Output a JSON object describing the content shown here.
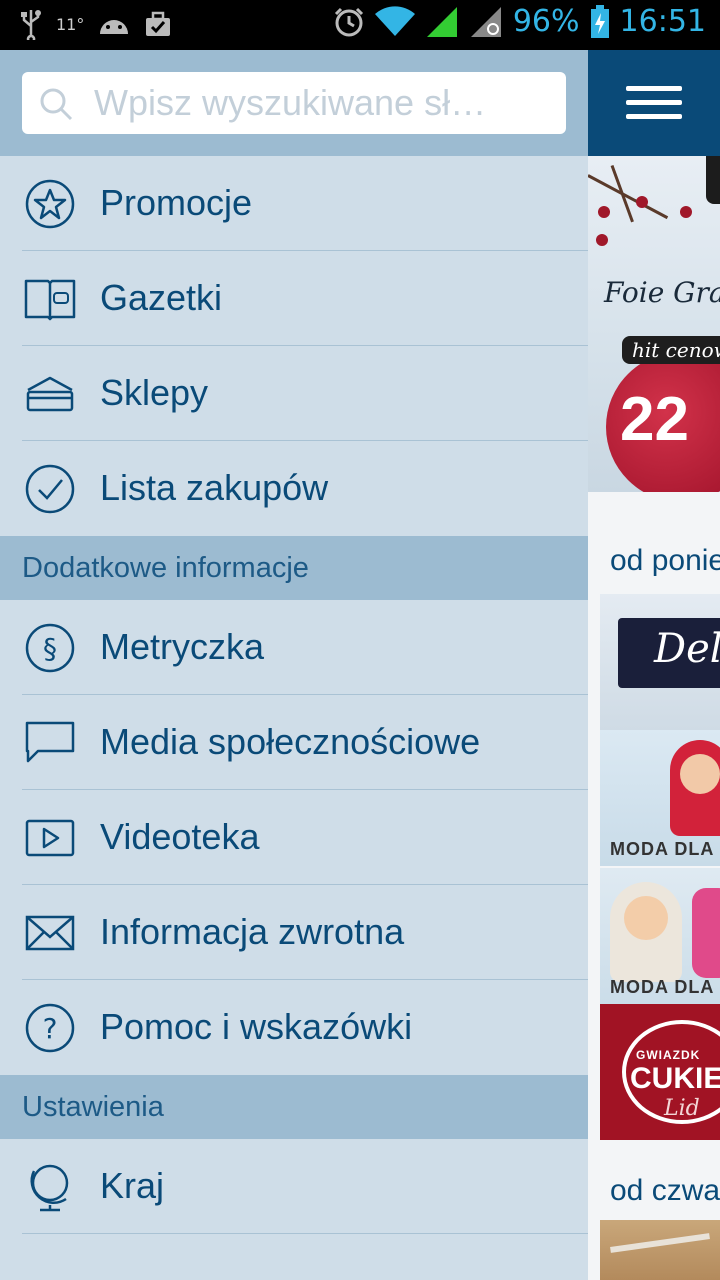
{
  "status_bar": {
    "temperature": "11°",
    "battery_percent": "96%",
    "time": "16:51",
    "icons": [
      "usb-icon",
      "android-icon",
      "briefcase-icon",
      "alarm-icon",
      "wifi-icon",
      "signal-icon",
      "signal-search-icon",
      "battery-charging-icon"
    ],
    "accent_color": "#33b5e5"
  },
  "drawer": {
    "search": {
      "placeholder": "Wpisz wyszukiwane sł…",
      "value": ""
    },
    "main_items": [
      {
        "label": "Promocje",
        "icon": "star-circle-icon"
      },
      {
        "label": "Gazetki",
        "icon": "open-book-icon"
      },
      {
        "label": "Sklepy",
        "icon": "store-icon"
      },
      {
        "label": "Lista zakupów",
        "icon": "check-circle-icon"
      }
    ],
    "sections": [
      {
        "title": "Dodatkowe informacje",
        "items": [
          {
            "label": "Metryczka",
            "icon": "section-sign-icon"
          },
          {
            "label": "Media społecznościowe",
            "icon": "speech-bubble-icon"
          },
          {
            "label": "Videoteka",
            "icon": "video-play-icon"
          },
          {
            "label": "Informacja zwrotna",
            "icon": "envelope-icon"
          },
          {
            "label": "Pomoc i wskazówki",
            "icon": "question-circle-icon"
          }
        ]
      },
      {
        "title": "Ustawienia",
        "items": [
          {
            "label": "Kraj",
            "icon": "globe-icon"
          }
        ]
      }
    ],
    "colors": {
      "panel": "#cfdde8",
      "header": "#9cbbd1",
      "text": "#0a4a78"
    }
  },
  "content": {
    "header_icon": "hamburger-menu-icon",
    "header_color": "#0a4a78",
    "banner": {
      "product": "Foie Gras",
      "badge": "hit cenowy",
      "price": "22"
    },
    "section_1": "od ponie",
    "tiles": [
      {
        "brand": "Deli",
        "caption": ""
      },
      {
        "caption": "MODA DLA"
      },
      {
        "caption": "MODA DLA M"
      },
      {
        "top_text": "GWIAZDK",
        "title": "CUKIE",
        "sub": "Lid"
      }
    ],
    "section_2": "od czwa"
  }
}
